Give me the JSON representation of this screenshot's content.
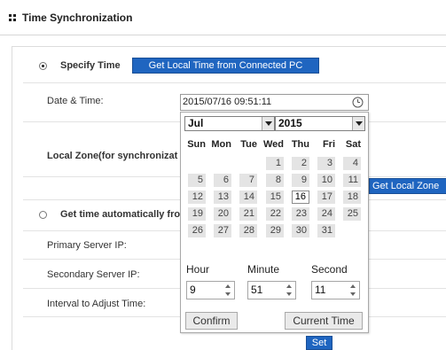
{
  "header": {
    "title": "Time Synchronization"
  },
  "specify": {
    "label": "Specify Time",
    "get_local_button": "Get Local Time from Connected PC"
  },
  "rows": {
    "date_time_label": "Date & Time:",
    "local_zone_label": "Local Zone(for synchronizat",
    "get_local_zone_button": "Get Local Zone"
  },
  "auto": {
    "label": "Get time automatically fro",
    "primary_label": "Primary Server IP:",
    "secondary_label": "Secondary Server IP:",
    "interval_label": "Interval to Adjust Time:",
    "set_button": "Set"
  },
  "datetime": {
    "value": "2015/07/16 09:51:11"
  },
  "picker": {
    "month": "Jul",
    "year": "2015",
    "weekdays": [
      "Sun",
      "Mon",
      "Tue",
      "Wed",
      "Thu",
      "Fri",
      "Sat"
    ],
    "weeks": [
      [
        "",
        "",
        "",
        "1",
        "2",
        "3",
        "4"
      ],
      [
        "5",
        "6",
        "7",
        "8",
        "9",
        "10",
        "11"
      ],
      [
        "12",
        "13",
        "14",
        "15",
        "16",
        "17",
        "18"
      ],
      [
        "19",
        "20",
        "21",
        "22",
        "23",
        "24",
        "25"
      ],
      [
        "26",
        "27",
        "28",
        "29",
        "30",
        "31",
        ""
      ]
    ],
    "selected_day": "16",
    "hour_label": "Hour",
    "minute_label": "Minute",
    "second_label": "Second",
    "hour": "9",
    "minute": "51",
    "second": "11",
    "confirm_button": "Confirm",
    "current_time_button": "Current Time"
  },
  "colors": {
    "accent": "#1f65c0"
  }
}
